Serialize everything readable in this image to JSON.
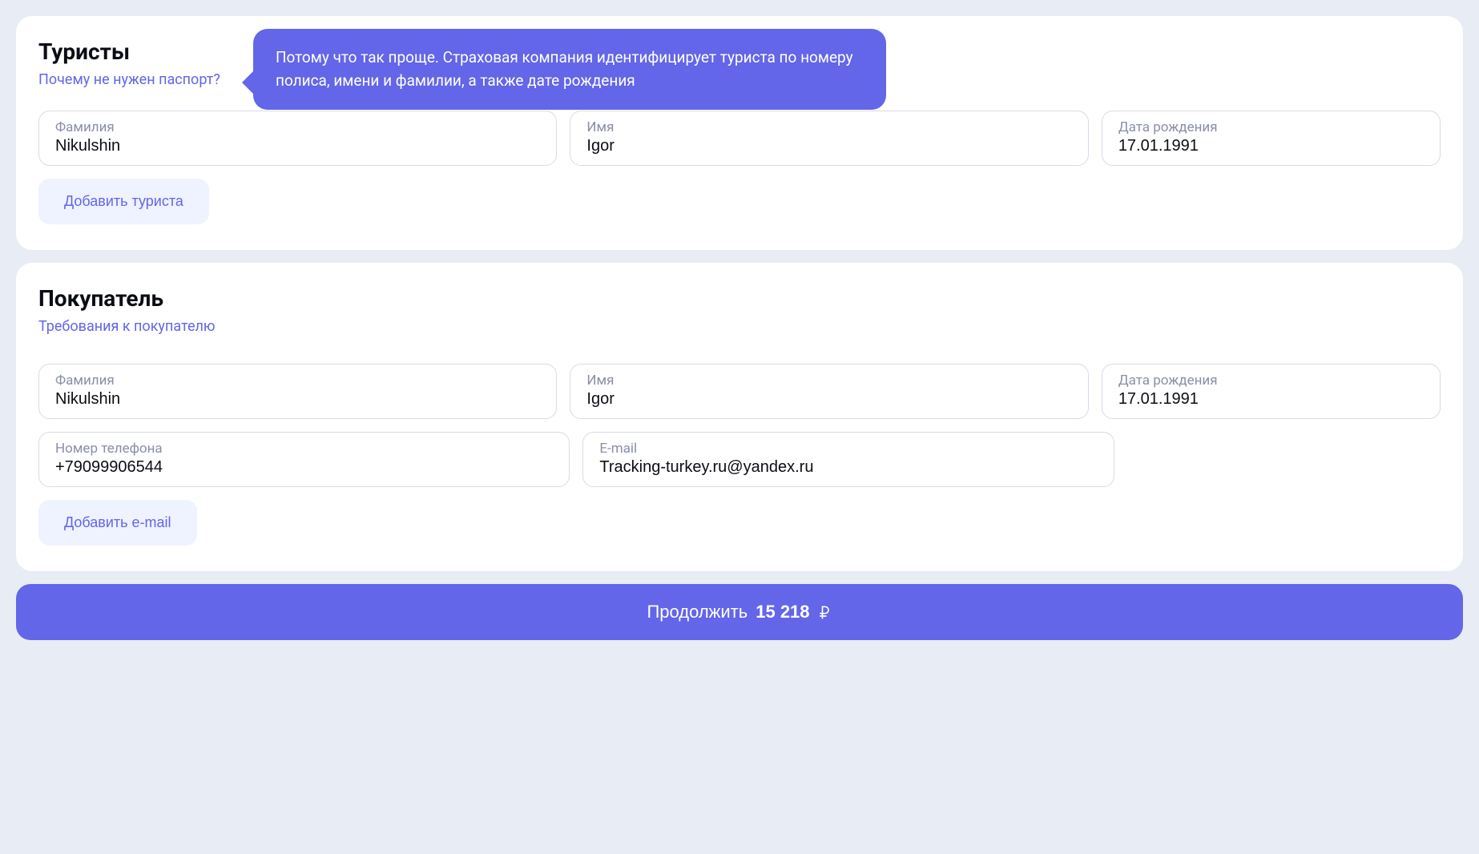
{
  "tourists": {
    "title": "Туристы",
    "passport_link": "Почему не нужен паспорт?",
    "tooltip_text": "Потому что так проще. Страховая компания идентифицирует туриста по номеру полиса, имени и фамилии, а также дате рождения",
    "fields": {
      "surname_label": "Фамилия",
      "surname_value": "Nikulshin",
      "name_label": "Имя",
      "name_value": "Igor",
      "birthdate_label": "Дата рождения",
      "birthdate_value": "17.01.1991"
    },
    "add_button": "Добавить туриста"
  },
  "buyer": {
    "title": "Покупатель",
    "requirements_link": "Требования к покупателю",
    "fields": {
      "surname_label": "Фамилия",
      "surname_value": "Nikulshin",
      "name_label": "Имя",
      "name_value": "Igor",
      "birthdate_label": "Дата рождения",
      "birthdate_value": "17.01.1991",
      "phone_label": "Номер телефона",
      "phone_value": "+79099906544",
      "email_label": "E-mail",
      "email_value": "Tracking-turkey.ru@yandex.ru"
    },
    "add_email_button": "Добавить e-mail"
  },
  "continue": {
    "label": "Продолжить",
    "price": "15 218"
  }
}
